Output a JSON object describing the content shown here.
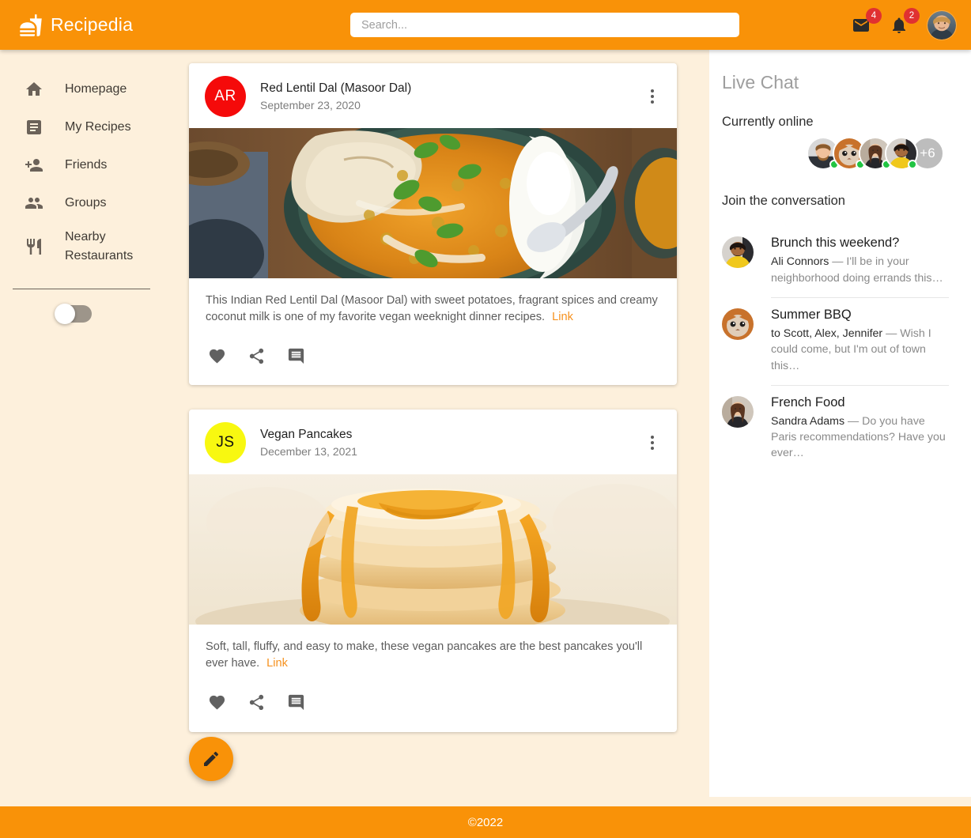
{
  "header": {
    "brand": "Recipedia",
    "logo_icon": "fastfood-icon",
    "search": {
      "placeholder": "Search...",
      "value": ""
    },
    "mail": {
      "icon": "mail-icon",
      "badge": "4"
    },
    "notifications": {
      "icon": "bell-icon",
      "badge": "2"
    },
    "account_avatar": "user-avatar"
  },
  "sidebar": {
    "items": [
      {
        "label": "Homepage",
        "icon": "home-icon"
      },
      {
        "label": "My Recipes",
        "icon": "article-icon"
      },
      {
        "label": "Friends",
        "icon": "person-add-icon"
      },
      {
        "label": "Groups",
        "icon": "groups-icon"
      },
      {
        "label": "Nearby Restaurants",
        "icon": "restaurant-icon"
      }
    ],
    "theme": {
      "icon": "moon-icon",
      "state": "off"
    }
  },
  "feed": {
    "posts": [
      {
        "initials": "AR",
        "avatar_color": "#f50a0a",
        "avatar_text_color": "#ffffff",
        "title": "Red Lentil Dal (Masoor Dal)",
        "date": "September 23, 2020",
        "description": "This Indian Red Lentil Dal (Masoor Dal) with sweet potatoes, fragrant spices and creamy coconut milk is one of my favorite vegan weeknight dinner recipes.",
        "link_label": "Link",
        "image_alt": "red lentil dal with rice, naan and cilantro in a dark bowl"
      },
      {
        "initials": "JS",
        "avatar_color": "#f8f810",
        "avatar_text_color": "#111111",
        "title": "Vegan Pancakes",
        "date": "December 13, 2021",
        "description": "Soft, tall, fluffy, and easy to make, these vegan pancakes are the best pancakes you'll ever have.",
        "link_label": "Link",
        "image_alt": "stack of fluffy pancakes with syrup pouring down"
      }
    ],
    "actions": {
      "like": "favorite-icon",
      "share": "share-icon",
      "comment": "comment-icon"
    },
    "fab": {
      "icon": "edit-icon",
      "label": "Create post"
    }
  },
  "chat": {
    "heading": "Live Chat",
    "online_label": "Currently online",
    "online_overflow": "+6",
    "online_count_avatars": 4,
    "join_label": "Join the conversation",
    "conversations": [
      {
        "title": "Brunch this weekend?",
        "who": "Ali Connors",
        "preview": " — I'll be in your neighborhood doing errands this…"
      },
      {
        "title": "Summer BBQ",
        "who": "to Scott, Alex, Jennifer",
        "preview": " — Wish I could come, but I'm out of town this…"
      },
      {
        "title": "French Food",
        "who": "Sandra Adams",
        "preview": " — Do you have Paris recommendations? Have you ever…"
      }
    ]
  },
  "footer": {
    "copyright": "©2022"
  },
  "colors": {
    "brand_orange": "#f99208",
    "page_cream": "#fdf0dc",
    "link_orange": "#f6911e",
    "badge_red": "#e03131",
    "online_green": "#21c443"
  }
}
